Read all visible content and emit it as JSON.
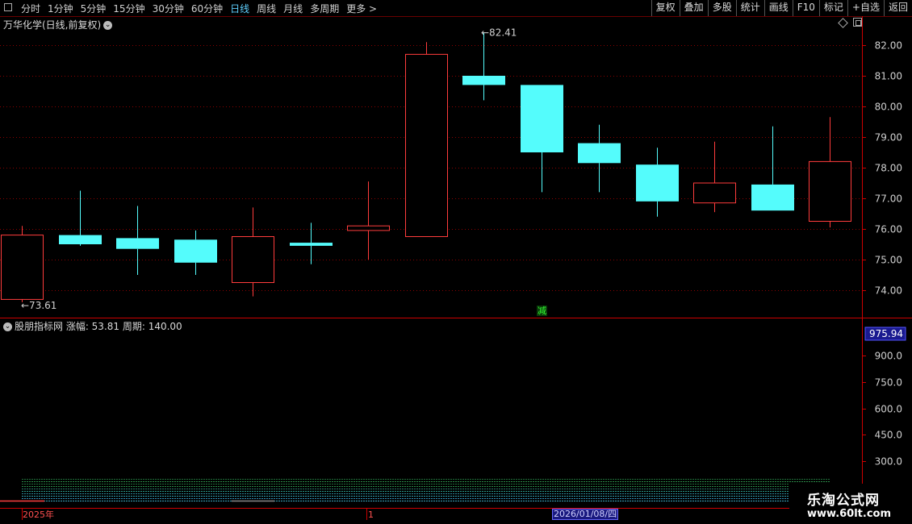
{
  "toolbar": {
    "periods": [
      "分时",
      "1分钟",
      "5分钟",
      "15分钟",
      "30分钟",
      "60分钟",
      "日线",
      "周线",
      "月线",
      "多周期",
      "更多 >"
    ],
    "active_period": "日线",
    "actions": [
      "复权",
      "叠加",
      "多股",
      "统计",
      "画线",
      "F10",
      "标记",
      "+自选",
      "返回"
    ]
  },
  "main": {
    "title": "万华化学(日线,前复权)",
    "high_label": "82.41",
    "low_label": "73.61",
    "marker": "减"
  },
  "sub": {
    "title": "股朋指标网 涨幅: 53.81 周期: 140.00",
    "current_value": "975.94"
  },
  "bottom": {
    "year_label": "2025年",
    "month_label": "1",
    "date_label": "2026/01/08/四"
  },
  "logo": {
    "line1": "乐淘公式网",
    "line2": "www.60lt.com"
  },
  "colors": {
    "up": "#ff3c3c",
    "down": "#54fcfc",
    "grid": "#8a0000",
    "axis": "#cc0000"
  },
  "chart_data": [
    {
      "type": "candlestick",
      "title": "万华化学(日线,前复权)",
      "ylim": [
        73.3,
        82.6
      ],
      "y_ticks": [
        74.0,
        75.0,
        76.0,
        77.0,
        78.0,
        79.0,
        80.0,
        81.0,
        82.0
      ],
      "candles": [
        {
          "open": 73.7,
          "close": 75.8,
          "high": 76.1,
          "low": 73.61
        },
        {
          "open": 75.8,
          "close": 75.5,
          "high": 77.25,
          "low": 75.45
        },
        {
          "open": 75.7,
          "close": 75.35,
          "high": 76.75,
          "low": 74.5
        },
        {
          "open": 75.65,
          "close": 74.9,
          "high": 75.95,
          "low": 74.5
        },
        {
          "open": 74.25,
          "close": 75.75,
          "high": 76.7,
          "low": 73.8
        },
        {
          "open": 75.55,
          "close": 75.45,
          "high": 76.2,
          "low": 74.85
        },
        {
          "open": 75.95,
          "close": 76.1,
          "high": 77.55,
          "low": 75.0
        },
        {
          "open": 75.75,
          "close": 81.7,
          "high": 82.1,
          "low": 75.75
        },
        {
          "open": 81.0,
          "close": 80.7,
          "high": 82.41,
          "low": 80.2
        },
        {
          "open": 80.7,
          "close": 78.5,
          "high": 80.7,
          "low": 77.2
        },
        {
          "open": 78.8,
          "close": 78.15,
          "high": 79.4,
          "low": 77.2
        },
        {
          "open": 78.1,
          "close": 76.9,
          "high": 78.65,
          "low": 76.4
        },
        {
          "open": 76.85,
          "close": 77.5,
          "high": 78.85,
          "low": 76.55
        },
        {
          "open": 77.45,
          "close": 76.6,
          "high": 79.35,
          "low": 76.6
        },
        {
          "open": 76.25,
          "close": 78.2,
          "high": 79.65,
          "low": 76.05
        }
      ]
    },
    {
      "type": "line",
      "title": "股朋指标网",
      "ylim": [
        180,
        1000
      ],
      "y_ticks": [
        300.0,
        450.0,
        600.0,
        750.0,
        900.0
      ],
      "current": 975.94
    }
  ]
}
